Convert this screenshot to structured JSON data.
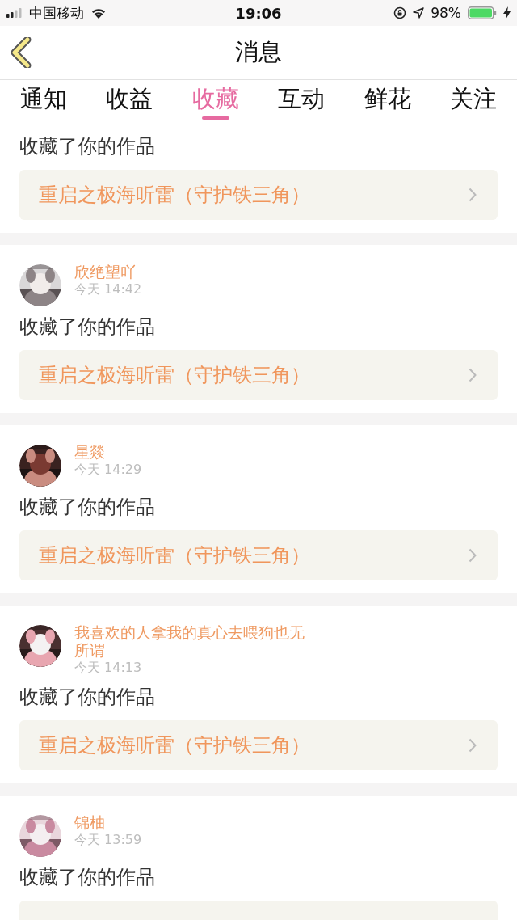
{
  "status_bar": {
    "carrier": "中国移动",
    "time": "19:06",
    "battery": "98%"
  },
  "nav": {
    "title": "消息"
  },
  "tabs": [
    {
      "label": "通知",
      "selected": false
    },
    {
      "label": "收益",
      "selected": false
    },
    {
      "label": "收藏",
      "selected": true
    },
    {
      "label": "互动",
      "selected": false
    },
    {
      "label": "鲜花",
      "selected": false
    },
    {
      "label": "关注",
      "selected": false
    }
  ],
  "messages": [
    {
      "action": "收藏了你的作品",
      "work": "重启之极海听雷（守护铁三角）"
    },
    {
      "user": "欣绝望吖",
      "time": "今天 14:42",
      "action": "收藏了你的作品",
      "work": "重启之极海听雷（守护铁三角）"
    },
    {
      "user": "星燚",
      "time": "今天 14:29",
      "action": "收藏了你的作品",
      "work": "重启之极海听雷（守护铁三角）"
    },
    {
      "user": "我喜欢的人拿我的真心去喂狗也无所谓",
      "time": "今天 14:13",
      "action": "收藏了你的作品",
      "work": "重启之极海听雷（守护铁三角）"
    },
    {
      "user": "锦柚",
      "time": "今天 13:59",
      "action": "收藏了你的作品"
    }
  ]
}
